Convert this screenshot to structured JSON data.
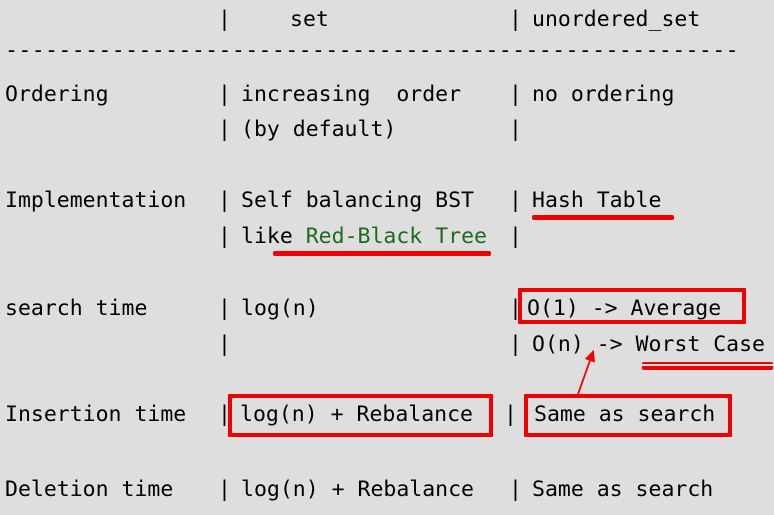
{
  "page": {
    "background_color": "#dedede",
    "text_color": "#000000",
    "accent_color": "#f00000",
    "highlight_text_color": "#1d6b1d",
    "title": "set vs unordered_set comparison table"
  },
  "table": {
    "separator": "-------------------------------------------------------",
    "header": {
      "label": "",
      "bar1": "|",
      "set": "set",
      "bar2": "|",
      "unordered_set": "unordered_set"
    },
    "rows": [
      {
        "label": "Ordering",
        "bar1": "|",
        "set": "increasing  order",
        "bar2": "|",
        "unordered_set": "no ordering",
        "cont": {
          "label": "",
          "bar1": "|",
          "set": "(by default)",
          "bar2": "|",
          "unordered_set": ""
        }
      },
      {
        "label": "Implementation",
        "bar1": "|",
        "set": "Self balancing BST",
        "bar2": "|",
        "unordered_set": "Hash Table",
        "cont": {
          "label": "",
          "bar1": "|",
          "set_prefix": "like ",
          "set_green": "Red-Black Tree",
          "bar2": "|",
          "unordered_set": ""
        }
      },
      {
        "label": "search time",
        "bar1": "|",
        "set": "log(n)",
        "bar2": "|",
        "unordered_set": "O(1) -> Average",
        "cont": {
          "label": "",
          "bar1": "|",
          "set": "",
          "bar2": "|",
          "unordered_set": "O(n) -> Worst Case"
        }
      },
      {
        "label": "Insertion time",
        "bar1": "|",
        "set": "log(n) + Rebalance",
        "bar2": "|",
        "unordered_set": "Same as search"
      },
      {
        "label": "Deletion time",
        "bar1": "|",
        "set": "log(n) + Rebalance",
        "bar2": "|",
        "unordered_set": "Same as search"
      }
    ]
  },
  "annotations": {
    "box_average": {
      "target": "O(1) -> Average",
      "color": "#f00000"
    },
    "box_insertion_set": {
      "target": "log(n) + Rebalance",
      "color": "#f00000"
    },
    "box_insertion_uset": {
      "target": "Same as search",
      "color": "#f00000"
    },
    "underline_hash_table": {
      "target": "Hash Table",
      "color": "#f00000"
    },
    "underline_red_black_tree": {
      "target": "Red-Black Tree",
      "color": "#f00000"
    },
    "underline_worst_case": {
      "target": "Worst Case",
      "color": "#f00000"
    },
    "arrow_to_on": {
      "from": "Same as search",
      "to": "O(n)",
      "color": "#f00000"
    }
  }
}
